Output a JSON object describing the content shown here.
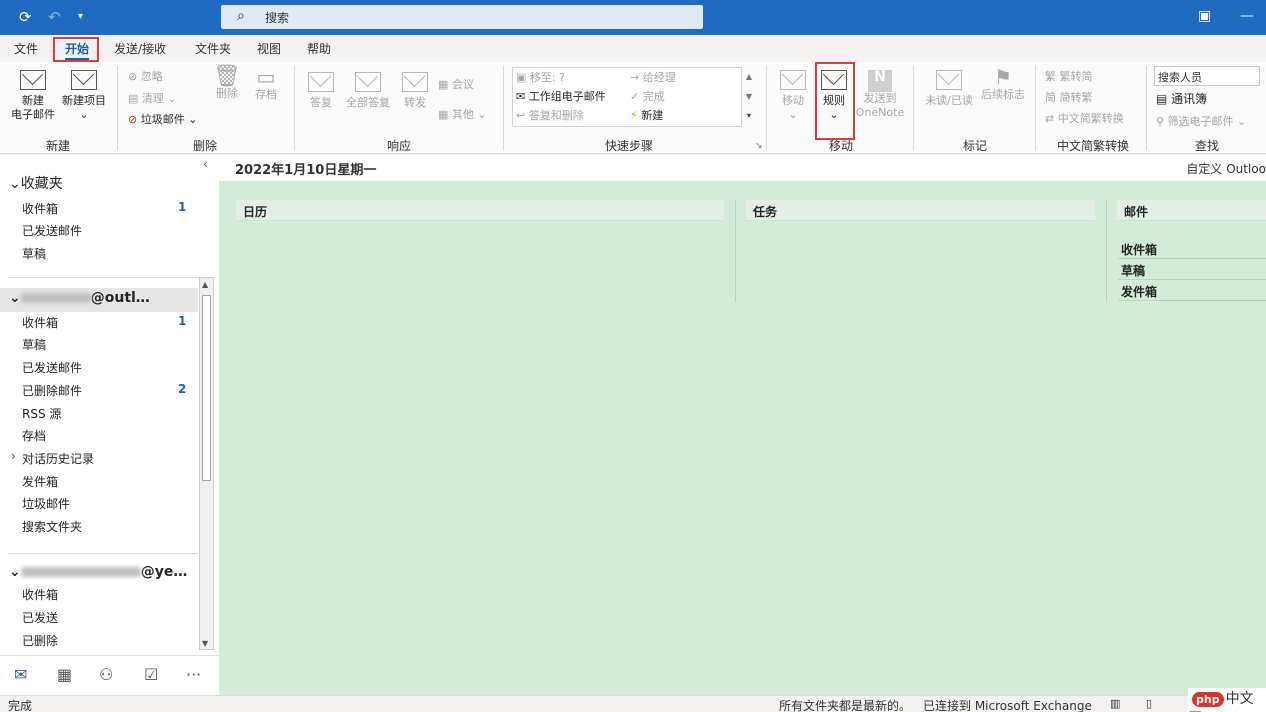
{
  "titlebar": {
    "search_placeholder": "搜索"
  },
  "menu": {
    "tabs": [
      "文件",
      "开始",
      "发送/接收",
      "文件夹",
      "视图",
      "帮助"
    ],
    "active": "开始"
  },
  "ribbon": {
    "new_group": {
      "label": "新建",
      "new_email": "新建\n电子邮件",
      "new_email_l1": "新建",
      "new_email_l2": "电子邮件",
      "new_item": "新建项目"
    },
    "delete_group": {
      "label": "删除",
      "ignore": "忽略",
      "cleanup": "清理",
      "junk": "垃圾邮件",
      "delete": "删除",
      "archive": "存档"
    },
    "respond_group": {
      "label": "响应",
      "reply": "答复",
      "reply_all": "全部答复",
      "forward": "转发",
      "meeting": "会议",
      "more": "其他"
    },
    "quicksteps_group": {
      "label": "快速步骤",
      "move_to": "移至: ?",
      "to_manager": "给经理",
      "team_email": "工作组电子邮件",
      "done": "完成",
      "reply_delete": "答复和删除",
      "create_new": "新建"
    },
    "move_group": {
      "label": "移动",
      "move": "移动",
      "rules": "规则",
      "onenote_l1": "发送到",
      "onenote_l2": "OneNote"
    },
    "tags_group": {
      "label": "标记",
      "unread_read": "未读/已读",
      "followup": "后续标志"
    },
    "chinese_group": {
      "label": "中文简繁转换",
      "to_trad": "繁转简",
      "to_simp": "简转繁",
      "convert": "中文简繁转换"
    },
    "find_group": {
      "label": "查找",
      "search_people": "搜索人员",
      "address_book": "通讯簿",
      "filter_email": "筛选电子邮件"
    }
  },
  "date_header": {
    "date": "2022年1月10日星期一",
    "customize": "自定义 Outloo"
  },
  "folders": {
    "favorites": {
      "title": "收藏夹",
      "items": [
        {
          "label": "收件箱",
          "count": "1"
        },
        {
          "label": "已发送邮件",
          "count": ""
        },
        {
          "label": "草稿",
          "count": ""
        }
      ]
    },
    "account1": {
      "title_suffix": "@outl…",
      "items": [
        {
          "label": "收件箱",
          "count": "1"
        },
        {
          "label": "草稿",
          "count": ""
        },
        {
          "label": "已发送邮件",
          "count": ""
        },
        {
          "label": "已删除邮件",
          "count": "2"
        },
        {
          "label": "RSS 源",
          "count": ""
        },
        {
          "label": "存档",
          "count": ""
        },
        {
          "label": "对话历史记录",
          "count": ""
        },
        {
          "label": "发件箱",
          "count": ""
        },
        {
          "label": "垃圾邮件",
          "count": ""
        },
        {
          "label": "搜索文件夹",
          "count": ""
        }
      ]
    },
    "account2": {
      "title_suffix": "@ye…",
      "items": [
        {
          "label": "收件箱"
        },
        {
          "label": "已发送"
        },
        {
          "label": "已删除"
        }
      ]
    }
  },
  "main": {
    "calendar": "日历",
    "tasks": "任务",
    "mail": "邮件",
    "mail_rows": [
      "收件箱",
      "草稿",
      "发件箱"
    ]
  },
  "statusbar": {
    "left": "完成",
    "sync": "所有文件夹都是最新的。",
    "connected": "已连接到 Microsoft Exchange"
  },
  "watermark": {
    "badge": "php",
    "text": "中文网"
  },
  "colors": {
    "titlebar": "#1f6bc1",
    "main_bg": "#d3ebd9",
    "highlight_box": "#e03b3b",
    "accent": "#1f5fb4"
  }
}
